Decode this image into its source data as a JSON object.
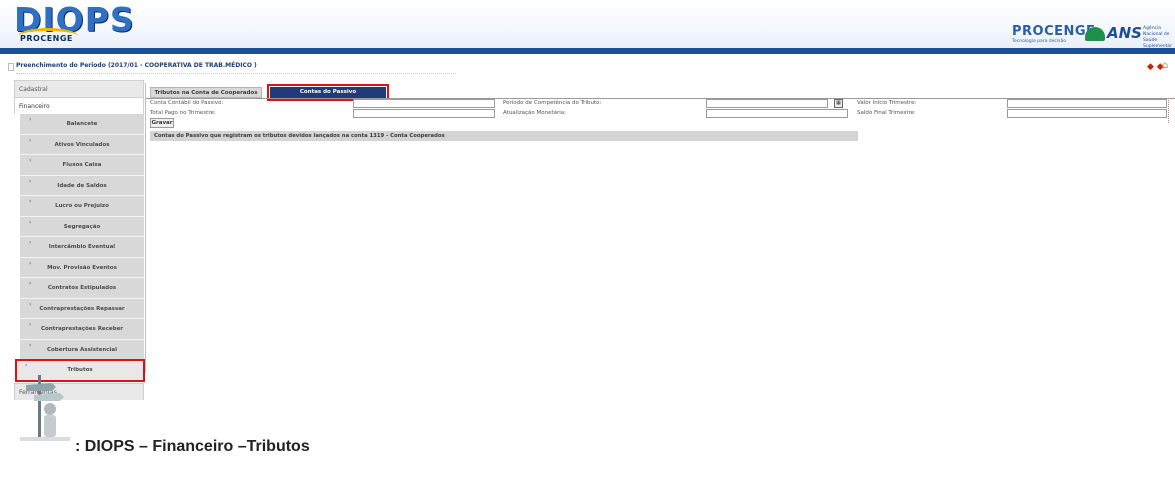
{
  "header": {
    "logo_text": "DIOPS",
    "logo_sub": "PROCENGE",
    "partner_logo_text": "PROCENGE",
    "partner_tagline": "Tecnologia para decisão",
    "ans_text": "ANS",
    "ans_tagline": "Agência Nacional de Saúde Suplementar"
  },
  "page": {
    "title": "Preenchimento do Periodo (2017/01 - COOPERATIVA DE TRAB.MÉDICO )",
    "nav_arrows": "◆ ◆",
    "home_glyph": "⌂"
  },
  "menu": {
    "section_cadastral": "Cadastral",
    "section_financeiro": "Financeiro",
    "section_ferramentas": "Ferramentas",
    "chevron": "›",
    "items": [
      {
        "label": "Balancete"
      },
      {
        "label": "Ativos Vinculados"
      },
      {
        "label": "Fluxos Caixa"
      },
      {
        "label": "Idade de Saldos"
      },
      {
        "label": "Lucro ou Prejuizo"
      },
      {
        "label": "Segregação"
      },
      {
        "label": "Intercâmbio Eventual"
      },
      {
        "label": "Mov. Provisão Eventos"
      },
      {
        "label": "Contratos Estipulados"
      },
      {
        "label": "Contraprestações Repassar"
      },
      {
        "label": "Contraprestações Receber"
      },
      {
        "label": "Cobertura Assistencial"
      },
      {
        "label": "Tributos"
      }
    ]
  },
  "tabs": {
    "tab1": "Tributos na Conta de Cooperados",
    "tab2": "Contas do Passivo"
  },
  "form": {
    "conta_contabil_label": "Conta Contábil do Passivo:",
    "periodo_label": "Periodo de Competência do Tributo:",
    "valor_inicio_label": "Valor Inicio Trimestre:",
    "total_pago_label": "Total Pago no Trimestre:",
    "atualizacao_label": "Atualização Monetária:",
    "saldo_final_label": "Saldo Final Trimestre:",
    "calendar_glyph": "▦",
    "save_label": "Gravar",
    "info_text": "Contas do Passivo que registram os tributos devidos lançados na conta 1319 - Conta Cooperados"
  },
  "caption": {
    "text": ": DIOPS – Financeiro –Tributos"
  },
  "colors": {
    "header_bar": "#1f4c9c",
    "active_tab": "#233a7a",
    "highlight": "#e01010"
  }
}
